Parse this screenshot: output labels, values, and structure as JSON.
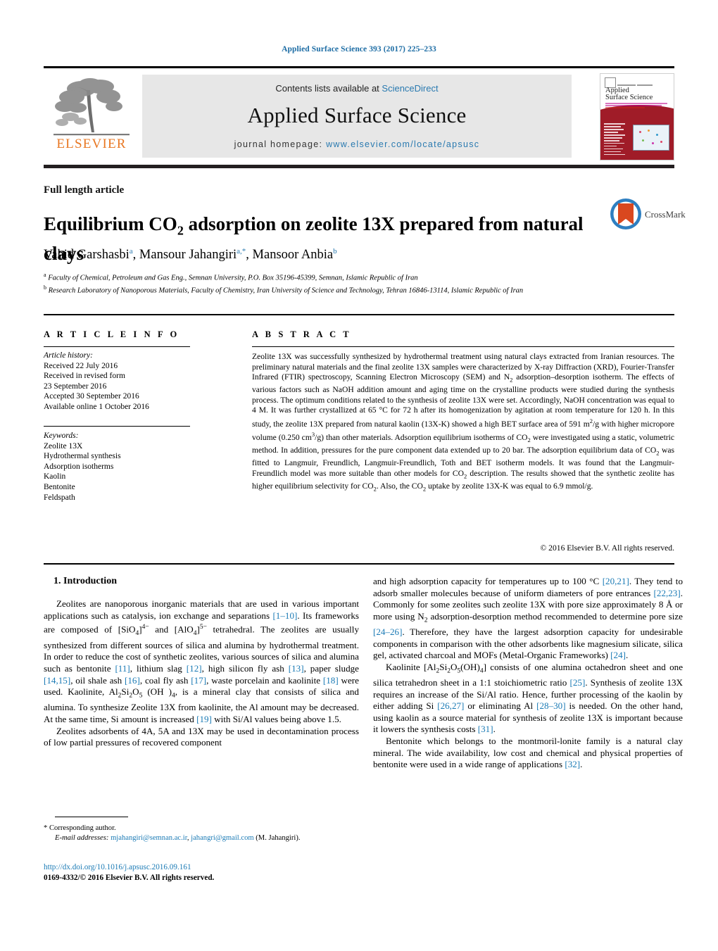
{
  "running_head": "Applied Surface Science 393 (2017) 225–233",
  "masthead": {
    "contents_prefix": "Contents lists available at ",
    "contents_link": "ScienceDirect",
    "journal_title": "Applied Surface Science",
    "homepage_prefix": "journal homepage: ",
    "homepage_url": "www.elsevier.com/locate/apsusc",
    "publisher_wordmark": "ELSEVIER",
    "cover_title_line1": "Applied",
    "cover_title_line2": "Surface Science"
  },
  "article": {
    "type": "Full length article",
    "title_part1": "Equilibrium CO",
    "title_sub": "2",
    "title_part2": " adsorption on zeolite 13X prepared from natural clays",
    "crossmark_label": "CrossMark",
    "authors": [
      {
        "name": "Vahid Garshasbi",
        "marks": "a"
      },
      {
        "name": "Mansour Jahangiri",
        "marks": "a,*"
      },
      {
        "name": "Mansoor Anbia",
        "marks": "b"
      }
    ],
    "affiliations": [
      {
        "mark": "a",
        "text": "Faculty of Chemical, Petroleum and Gas Eng., Semnan University, P.O. Box 35196-45399, Semnan, Islamic Republic of Iran"
      },
      {
        "mark": "b",
        "text": "Research Laboratory of Nanoporous Materials, Faculty of Chemistry, Iran University of Science and Technology, Tehran 16846-13114, Islamic Republic of Iran"
      }
    ]
  },
  "info": {
    "heading": "A R T I C L E  I N F O",
    "history_label": "Article history:",
    "history": [
      "Received 22 July 2016",
      "Received in revised form",
      "23 September 2016",
      "Accepted 30 September 2016",
      "Available online 1 October 2016"
    ],
    "keywords_label": "Keywords:",
    "keywords": [
      "Zeolite 13X",
      "Hydrothermal synthesis",
      "Adsorption isotherms",
      "Kaolin",
      "Bentonite",
      "Feldspath"
    ]
  },
  "abstract": {
    "heading": "A B S T R A C T",
    "text_1": "Zeolite 13X was successfully synthesized by hydrothermal treatment using natural clays extracted from Iranian resources. The preliminary natural materials and the final zeolite 13X samples were characterized by X-ray Diffraction (XRD), Fourier-Transfer Infrared (FTIR) spectroscopy, Scanning Electron Microscopy (SEM) and N",
    "text_1_sub": "2",
    "text_2": " adsorption–desorption isotherm. The effects of various factors such as NaOH addition amount and aging time on the crystalline products were studied during the synthesis process. The optimum conditions related to the synthesis of zeolite 13X were set. Accordingly, NaOH concentration was equal to 4 M. It was further crystallized at 65 °C for 72 h after its homogenization by agitation at room temperature for 120 h. In this study, the zeolite 13X prepared from natural kaolin (13X-K) showed a high BET surface area of 591 m",
    "sup_2": "2",
    "text_3": "/g with higher micropore volume (0.250 cm",
    "sup_3": "3",
    "text_4": "/g) than other materials. Adsorption equilibrium isotherms of CO",
    "sub_co2_a": "2",
    "text_5": " were investigated using a static, volumetric method. In addition, pressures for the pure component data extended up to 20 bar. The adsorption equilibrium data of CO",
    "sub_co2_b": "2",
    "text_6": " was fitted to Langmuir, Freundlich, Langmuir-Freundlich, Toth and BET isotherm models. It was found that the Langmuir-Freundlich model was more suitable than other models for CO",
    "sub_co2_c": "2",
    "text_7": " description. The results showed that the synthetic zeolite has higher equilibrium selectivity for CO",
    "sub_co2_d": "2",
    "text_8": ". Also, the CO",
    "sub_co2_e": "2",
    "text_9": " uptake by zeolite 13X-K was equal to 6.9 mmol/g.",
    "copyright": "© 2016 Elsevier B.V. All rights reserved."
  },
  "body": {
    "section_number_title": "1.  Introduction",
    "left_p1_a": "Zeolites are nanoporous inorganic materials that are used in various important applications such as catalysis, ion exchange and separations ",
    "left_p1_r1": "[1–10]",
    "left_p1_b": ". Its frameworks are composed of [SiO",
    "left_p1_s1": "4",
    "left_p1_c": "]",
    "left_p1_sup1": "4−",
    "left_p1_d": " and [AlO",
    "left_p1_s2": "4",
    "left_p1_e": "]",
    "left_p1_sup2": "5−",
    "left_p1_f": " tetrahedral. The zeolites are usually synthesized from different sources of silica and alumina by hydrothermal treatment. In order to reduce the cost of synthetic zeolites, various sources of silica and alumina such as bentonite ",
    "left_p1_r2": "[11]",
    "left_p1_g": ", lithium slag ",
    "left_p1_r3": "[12]",
    "left_p1_h": ", high silicon fly ash ",
    "left_p1_r4": "[13]",
    "left_p1_i": ", paper sludge ",
    "left_p1_r5": "[14,15]",
    "left_p1_j": ", oil shale ash ",
    "left_p1_r6": "[16]",
    "left_p1_k": ", coal fly ash ",
    "left_p1_r7": "[17]",
    "left_p1_l": ", waste porcelain and kaolinite ",
    "left_p1_r8": "[18]",
    "left_p1_m": " were used. Kaolinite, Al",
    "left_p1_s3": "2",
    "left_p1_n": "Si",
    "left_p1_s4": "2",
    "left_p1_o": "O",
    "left_p1_s5": "5",
    "left_p1_p": " (OH )",
    "left_p1_s6": "4",
    "left_p1_q": ", is a mineral clay that consists of silica and alumina. To synthesize Zeolite 13X from kaolinite, the Al amount may be decreased. At the same time, Si amount is increased ",
    "left_p1_r9": "[19]",
    "left_p1_t": " with Si/Al values being above 1.5.",
    "left_p2": "Zeolites adsorbents of 4A, 5A and 13X may be used in decontamination process of low partial pressures of recovered component",
    "right_p1_a": "and high adsorption capacity for temperatures up to 100 °C ",
    "right_p1_r1": "[20,21]",
    "right_p1_b": ". They tend to adsorb smaller molecules because of uniform diameters of pore entrances ",
    "right_p1_r2": "[22,23]",
    "right_p1_c": ". Commonly for some zeolites such zeolite 13X with pore size approximately 8 Å or more using N",
    "right_p1_s1": "2",
    "right_p1_d": " adsorption-desorption method recommended to determine pore size ",
    "right_p1_r3": "[24–26]",
    "right_p1_e": ". Therefore, they have the largest adsorption capacity for undesirable components in comparison with the other adsorbents like magnesium silicate, silica gel, activated charcoal and MOFs (Metal-Organic Frameworks) ",
    "right_p1_r4": "[24]",
    "right_p1_f": ".",
    "right_p2_a": "Kaolinite [Al",
    "right_p2_s1": "2",
    "right_p2_b": "Si",
    "right_p2_s2": "2",
    "right_p2_c": "O",
    "right_p2_s3": "5",
    "right_p2_d": "(OH)",
    "right_p2_s4": "4",
    "right_p2_e": "] consists of one alumina octahedron sheet and one silica tetrahedron sheet in a 1:1 stoichiometric ratio ",
    "right_p2_r1": "[25]",
    "right_p2_f": ". Synthesis of zeolite 13X requires an increase of the Si/Al ratio. Hence, further processing of the kaolin by either adding Si ",
    "right_p2_r2": "[26,27]",
    "right_p2_g": " or eliminating Al ",
    "right_p2_r3": "[28–30]",
    "right_p2_h": " is needed. On the other hand, using kaolin as a source material for synthesis of zeolite 13X is important because it lowers the synthesis costs ",
    "right_p2_r4": "[31]",
    "right_p2_i": ".",
    "right_p3_a": "Bentonite which belongs to the montmoril-lonite family is a natural clay mineral. The wide availability, low cost and chemical and physical properties of bentonite were used in a wide range of applications ",
    "right_p3_r1": "[32]",
    "right_p3_b": "."
  },
  "footer": {
    "corresponding_mark": "*",
    "corresponding_text": "Corresponding author.",
    "email_label": "E-mail addresses:",
    "email_1": "mjahangiri@semnan.ac.ir",
    "email_sep": ", ",
    "email_2": "jahangri@gmail.com",
    "email_suffix": " (M. Jahangiri).",
    "doi": "http://dx.doi.org/10.1016/j.apsusc.2016.09.161",
    "issn_line": "0169-4332/© 2016 Elsevier B.V. All rights reserved."
  }
}
